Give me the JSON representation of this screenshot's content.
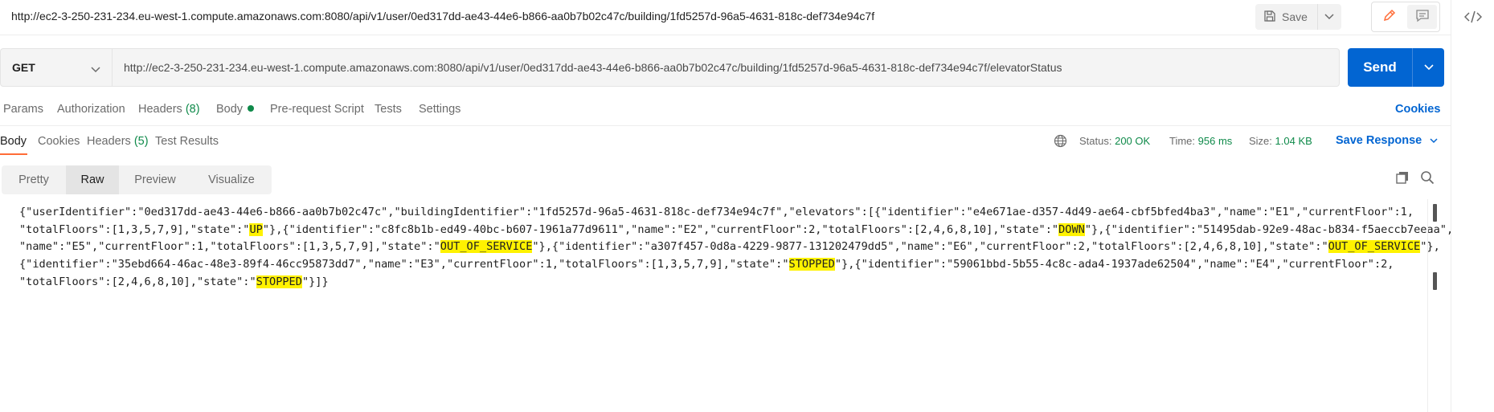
{
  "request": {
    "title": "http://ec2-3-250-231-234.eu-west-1.compute.amazonaws.com:8080/api/v1/user/0ed317dd-ae43-44e6-b866-aa0b7b02c47c/building/1fd5257d-96a5-4631-818c-def734e94c7f",
    "method": "GET",
    "url": "http://ec2-3-250-231-234.eu-west-1.compute.amazonaws.com:8080/api/v1/user/0ed317dd-ae43-44e6-b866-aa0b7b02c47c/building/1fd5257d-96a5-4631-818c-def734e94c7f/elevatorStatus"
  },
  "toolbar": {
    "save_label": "Save",
    "send_label": "Send"
  },
  "request_tabs": {
    "params": "Params",
    "authorization": "Authorization",
    "headers": "Headers",
    "headers_count": "(8)",
    "body": "Body",
    "pre_request": "Pre-request Script",
    "tests": "Tests",
    "settings": "Settings",
    "cookies": "Cookies"
  },
  "response_tabs": {
    "body": "Body",
    "cookies": "Cookies",
    "headers": "Headers",
    "headers_count": "(5)",
    "test_results": "Test Results"
  },
  "response_status": {
    "status_label": "Status:",
    "status_value": "200 OK",
    "time_label": "Time:",
    "time_value": "956 ms",
    "size_label": "Size:",
    "size_value": "1.04 KB",
    "save_response": "Save Response"
  },
  "format_tabs": {
    "pretty": "Pretty",
    "raw": "Raw",
    "preview": "Preview",
    "visualize": "Visualize",
    "selected": "Raw"
  },
  "response_body": {
    "line1_a": "{\"userIdentifier\":\"0ed317dd-ae43-44e6-b866-aa0b7b02c47c\",\"buildingIdentifier\":\"1fd5257d-96a5-4631-818c-def734e94c7f\",\"elevators\":[{\"identifier\":\"e4e671ae-d357-4d49-ae64-cbf5bfed4ba3\",\"name\":\"E1\",\"currentFloor\":1,",
    "line2_a": "\"totalFloors\":[1,3,5,7,9],\"state\":\"",
    "line2_hl1": "UP",
    "line2_b": "\"},{\"identifier\":\"c8fc8b1b-ed49-40bc-b607-1961a77d9611\",\"name\":\"E2\",\"currentFloor\":2,\"totalFloors\":[2,4,6,8,10],\"state\":\"",
    "line2_hl2": "DOWN",
    "line2_c": "\"},{\"identifier\":\"51495dab-92e9-48ac-b834-f5aeccb7eeaa\",",
    "line3_a": "\"name\":\"E5\",\"currentFloor\":1,\"totalFloors\":[1,3,5,7,9],\"state\":\"",
    "line3_hl1": "OUT_OF_SERVICE",
    "line3_b": "\"},{\"identifier\":\"a307f457-0d8a-4229-9877-131202479dd5\",\"name\":\"E6\",\"currentFloor\":2,\"totalFloors\":[2,4,6,8,10],\"state\":\"",
    "line3_hl2": "OUT_OF_SERVICE",
    "line3_c": "\"},",
    "line4_a": "{\"identifier\":\"35ebd664-46ac-48e3-89f4-46cc95873dd7\",\"name\":\"E3\",\"currentFloor\":1,\"totalFloors\":[1,3,5,7,9],\"state\":\"",
    "line4_hl1": "STOPPED",
    "line4_b": "\"},{\"identifier\":\"59061bbd-5b55-4c8c-ada4-1937ade62504\",\"name\":\"E4\",\"currentFloor\":2,",
    "line5_a": "\"totalFloors\":[2,4,6,8,10],\"state\":\"",
    "line5_hl1": "STOPPED",
    "line5_b": "\"}]}"
  },
  "colors": {
    "accent": "#0265d2",
    "active_tab_underline": "#ff6c37",
    "status_ok": "#0f8a4a",
    "highlight": "#fff200"
  }
}
